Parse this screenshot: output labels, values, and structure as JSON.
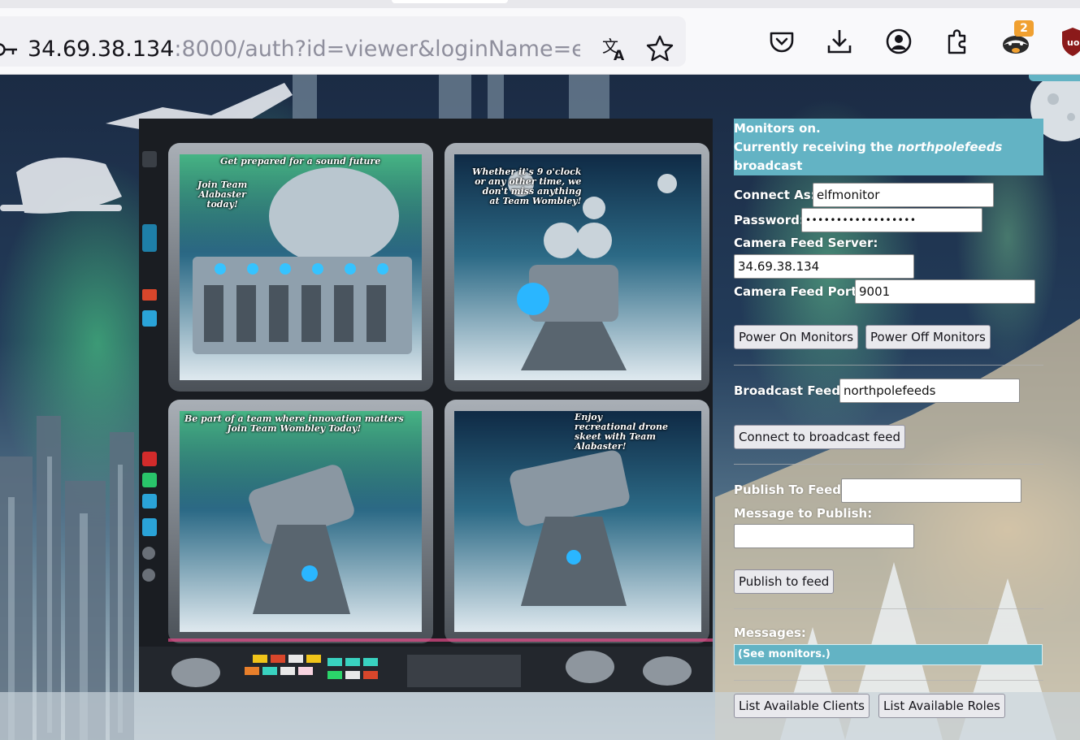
{
  "browser": {
    "url_host": "34.69.38.134",
    "url_rest": ":8000/auth?id=viewer&loginName=e",
    "extension_badge": "2",
    "icons": [
      "key-icon",
      "translate-icon",
      "bookmark-star-icon",
      "pocket-icon",
      "download-icon",
      "account-icon",
      "extensions-icon",
      "badger-extension-icon",
      "ublock-icon"
    ]
  },
  "monitor": {
    "captions": [
      "Get prepared for a sound future",
      "Join Team\nAlabaster\ntoday!",
      "Whether it's 9 o'clock\nor any other time, we\ndon't miss anything\nat Team Wombley!",
      "Be part of a team where innovation matters\nJoin Team Wombley Today!",
      "Enjoy\nrecreational drone\nskeet with Team\nAlabaster!"
    ]
  },
  "status": {
    "line1": "Monitors on.",
    "line2_prefix": "Currently receiving the ",
    "feed_name": "northpolefeeds",
    "line3": "broadcast"
  },
  "form": {
    "connect_as_label": "Connect As:",
    "connect_as_value": "elfmonitor",
    "password_label": "Password:",
    "password_value": "••••••••••••••••••",
    "camera_server_label": "Camera Feed Server:",
    "camera_server_value": "34.69.38.134",
    "camera_port_label": "Camera Feed Port:",
    "camera_port_value": "9001",
    "power_on_label": "Power On Monitors",
    "power_off_label": "Power Off Monitors",
    "broadcast_feed_label": "Broadcast Feed:",
    "broadcast_feed_value": "northpolefeeds",
    "connect_broadcast_label": "Connect to broadcast feed",
    "publish_to_feed_label": "Publish To Feed:",
    "publish_to_feed_value": "",
    "message_label": "Message to Publish:",
    "message_value": "",
    "publish_button_label": "Publish to feed",
    "messages_label": "Messages:",
    "messages_value": "(See monitors.)",
    "list_clients_label": "List Available Clients",
    "list_roles_label": "List Available Roles"
  },
  "colors": {
    "accent": "#63b3c4",
    "button_bg": "#e9e9ed",
    "toolbar_bg": "#f9f9fb"
  }
}
